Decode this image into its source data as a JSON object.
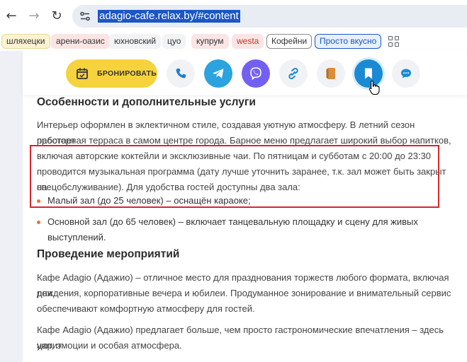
{
  "browser": {
    "url": "adagio-cafe.relax.by/#content",
    "bookmarks": [
      {
        "label": "шляхецки"
      },
      {
        "label": "арени-оазис"
      },
      {
        "label": "юхновский"
      },
      {
        "label": "цуо"
      },
      {
        "label": "купрум"
      },
      {
        "label": "westa"
      },
      {
        "label": "Кофейни"
      },
      {
        "label": "Просто вкусно"
      }
    ]
  },
  "toolbar": {
    "book_label": "БРОНИРОВАТЬ",
    "buttons": [
      "phone-icon",
      "telegram-icon",
      "viber-icon",
      "share-link-icon",
      "menu-book-icon",
      "bookmark-icon",
      "chat-icon"
    ],
    "colors": {
      "book": "#f6d23d",
      "telegram": "#2aa3e0",
      "viber": "#7360f2",
      "bookmark": "#1a8ad4"
    }
  },
  "content": {
    "section1_title": "Особенности и дополнительные услуги",
    "para1_line1": "Интерьер оформлен в эклектичном стиле, создавая уютную атмосферу. В летний сезон работает",
    "para1_line2": "просторная терраса в самом центре города. Барное меню предлагает широкий выбор напитков,",
    "para1_line3": "включая авторские коктейли и эксклюзивные чаи. По пятницам и субботам с 20:00 до 23:30",
    "para1_line4": "проводится музыкальная программа (дату лучше уточнить заранее, т.к. зал может быть закрыт на",
    "para1_line5": "спецобслуживание). Для удобства гостей доступны два зала:",
    "list_item1": "Малый зал (до 25 человек) – оснащён караоке;",
    "list_item2_line1": "Основной зал (до 65 человек) – включает танцевальную площадку и сцену для живых",
    "list_item2_line2": "выступлений.",
    "section2_title": "Проведение мероприятий",
    "para2_line1": "Кафе Adagio (Адажио) – отличное место для празднования торжеств любого формата, включая дни",
    "para2_line2": "рождения, корпоративные вечера и юбилеи. Продуманное зонирование и внимательный сервис",
    "para2_line3": "обеспечивают комфортную атмосферу для гостей.",
    "para3_line1": "Кафе Adagio (Адажио) предлагает больше, чем просто гастрономические впечатления – здесь царит",
    "para3_line2": "уют, эмоции и особая атмосфера."
  }
}
